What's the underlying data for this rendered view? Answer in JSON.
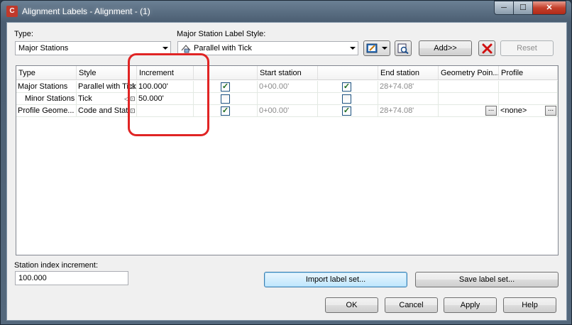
{
  "window": {
    "title": "Alignment Labels - Alignment - (1)",
    "minimize_label": "─",
    "maximize_label": "☐",
    "close_label": "✕"
  },
  "type_section": {
    "label": "Type:",
    "selected": "Major Stations"
  },
  "style_section": {
    "label": "Major Station Label Style:",
    "selected": "Parallel with Tick"
  },
  "toolbar": {
    "add_label": "Add>>",
    "reset_label": "Reset",
    "delete_icon": "red-x-icon"
  },
  "grid": {
    "columns": [
      "Type",
      "Style",
      "Increment",
      "",
      "Start station",
      "",
      "End station",
      "Geometry Poin...",
      "Profile"
    ],
    "rows": [
      {
        "type": "Major Stations",
        "style": "Parallel with Tick",
        "increment": "100.000'",
        "start_checked": true,
        "start": "0+00.00'",
        "end_checked": true,
        "end": "28+74.08'",
        "geometry": "",
        "profile": ""
      },
      {
        "type": "Minor Stations",
        "style": "Tick",
        "increment": "50.000'",
        "start_checked": false,
        "start": "",
        "end_checked": false,
        "end": "",
        "geometry": "",
        "profile": ""
      },
      {
        "type": "Profile Geome...",
        "style": "Code and Stati",
        "increment": "",
        "start_checked": true,
        "start": "0+00.00'",
        "end_checked": true,
        "end": "28+74.08'",
        "geometry": "",
        "profile": "<none>"
      }
    ]
  },
  "station_index": {
    "label": "Station index increment:",
    "value": "100.000"
  },
  "buttons": {
    "import": "Import label set...",
    "save": "Save label set...",
    "ok": "OK",
    "cancel": "Cancel",
    "apply": "Apply",
    "help": "Help"
  },
  "colors": {
    "annotation": "#e02424",
    "checkmark": "#1c6b1c"
  }
}
